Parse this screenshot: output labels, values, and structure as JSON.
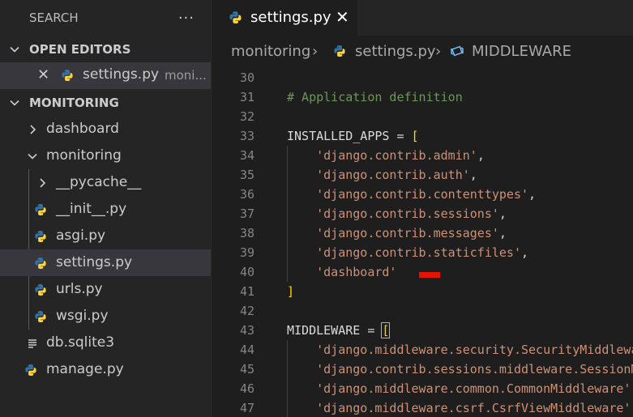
{
  "sidebar": {
    "title": "SEARCH",
    "more_icon": "···",
    "open_editors": {
      "title": "OPEN EDITORS",
      "item": {
        "name": "settings.py",
        "dir": "moni..."
      }
    },
    "project": {
      "title": "MONITORING",
      "items": [
        {
          "label": "dashboard",
          "icon": "chevron-right-icon"
        },
        {
          "label": "monitoring",
          "icon": "chevron-down-icon"
        },
        {
          "label": "__pycache__",
          "icon": "chevron-right-icon"
        },
        {
          "label": "__init__.py",
          "icon": "python-icon"
        },
        {
          "label": "asgi.py",
          "icon": "python-icon"
        },
        {
          "label": "settings.py",
          "icon": "python-icon",
          "active": true
        },
        {
          "label": "urls.py",
          "icon": "python-icon"
        },
        {
          "label": "wsgi.py",
          "icon": "python-icon"
        },
        {
          "label": "db.sqlite3",
          "icon": "list-icon"
        },
        {
          "label": "manage.py",
          "icon": "python-icon"
        }
      ]
    }
  },
  "tab": {
    "label": "settings.py",
    "close": "✕"
  },
  "breadcrumb": {
    "folder": "monitoring",
    "file": "settings.py",
    "symbol": "MIDDLEWARE",
    "separator": "›"
  },
  "editor": {
    "lines": [
      {
        "n": "30",
        "text": ""
      },
      {
        "n": "31",
        "text": "# Application definition"
      },
      {
        "n": "32",
        "text": ""
      },
      {
        "n": "33",
        "var": "INSTALLED_APPS",
        "op": " = ",
        "br": "["
      },
      {
        "n": "34",
        "indent": "    ",
        "str": "'django.contrib.admin'",
        "tail": ","
      },
      {
        "n": "35",
        "indent": "    ",
        "str": "'django.contrib.auth'",
        "tail": ","
      },
      {
        "n": "36",
        "indent": "    ",
        "str": "'django.contrib.contenttypes'",
        "tail": ","
      },
      {
        "n": "37",
        "indent": "    ",
        "str": "'django.contrib.sessions'",
        "tail": ","
      },
      {
        "n": "38",
        "indent": "    ",
        "str": "'django.contrib.messages'",
        "tail": ","
      },
      {
        "n": "39",
        "indent": "    ",
        "str": "'django.contrib.staticfiles'",
        "tail": ","
      },
      {
        "n": "40",
        "indent": "    ",
        "str": "'dashboard'",
        "tail": ""
      },
      {
        "n": "41",
        "br": "]"
      },
      {
        "n": "42",
        "text": ""
      },
      {
        "n": "43",
        "var": "MIDDLEWARE",
        "op": " = ",
        "br": "[",
        "box": true
      },
      {
        "n": "44",
        "indent": "    ",
        "str": "'django.middleware.security.SecurityMiddleware'",
        "tail": ","
      },
      {
        "n": "45",
        "indent": "    ",
        "str": "'django.contrib.sessions.middleware.SessionMiddleware'",
        "tail": ","
      },
      {
        "n": "46",
        "indent": "    ",
        "str": "'django.middleware.common.CommonMiddleware'",
        "tail": ","
      },
      {
        "n": "47",
        "indent": "    ",
        "str": "'django.middleware.csrf.CsrfViewMiddleware'",
        "tail": ","
      }
    ]
  },
  "colors": {
    "python_blue": "#3572a5",
    "python_yellow": "#ffd43b",
    "error": "#e51400",
    "symbol_icon": "#75beff"
  }
}
